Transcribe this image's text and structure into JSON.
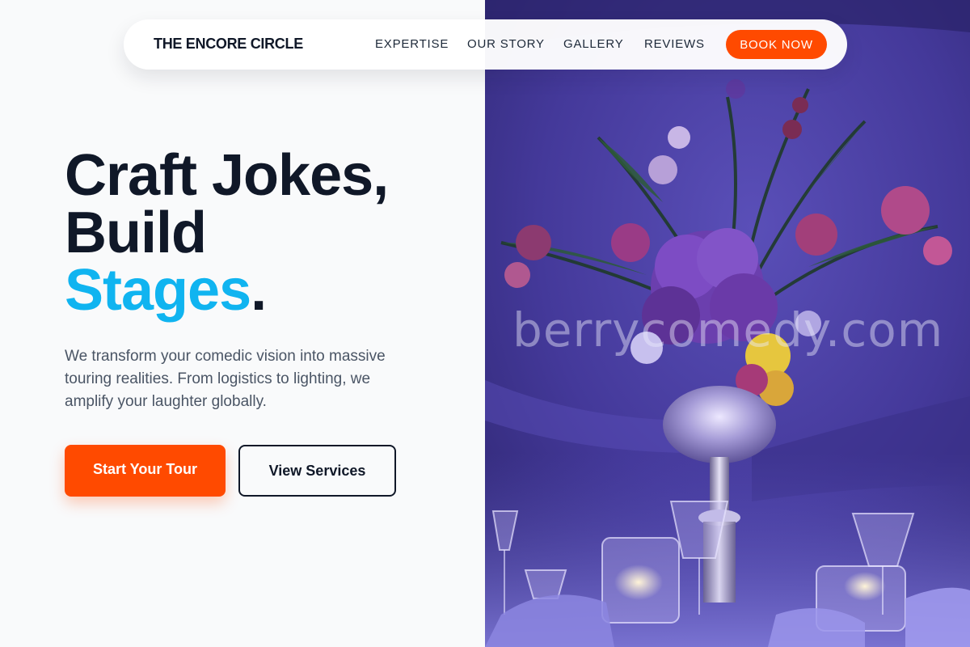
{
  "nav": {
    "brand": "THE ENCORE CIRCLE",
    "links": [
      {
        "label": "EXPERTISE"
      },
      {
        "label": "OUR STORY"
      },
      {
        "label": "GALLERY"
      },
      {
        "label": "REVIEWS"
      }
    ],
    "cta_label": "BOOK NOW"
  },
  "hero": {
    "title_line1": "Craft Jokes,",
    "title_line2": "Build",
    "title_accent": "Stages",
    "title_dot": ".",
    "subtitle": "We transform your comedic vision into massive touring realities. From logistics to lighting, we amplify your laughter globally.",
    "primary_button": "Start Your Tour",
    "secondary_button": "View Services"
  },
  "image": {
    "watermark": "berrycomedy.com"
  },
  "colors": {
    "accent_orange": "#ff4a00",
    "accent_blue": "#10b4f0",
    "ink": "#101828",
    "image_tone": "#3f3790"
  }
}
